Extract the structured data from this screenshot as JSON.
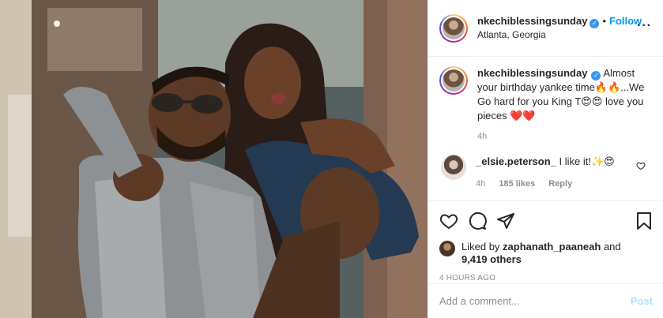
{
  "post": {
    "username": "nkechiblessingsunday",
    "verified_icon": "verified-badge-icon",
    "follow_label": "Follow",
    "separator": "•",
    "location": "Atlanta, Georgia",
    "more_label": "···"
  },
  "caption": {
    "username": "nkechiblessingsunday",
    "text": "Almost your birthday yankee time🔥🔥...We Go hard for you King T😍😍 love you pieces ❤️❤️",
    "time": "4h"
  },
  "comments": [
    {
      "username": "_elsie.peterson_",
      "text": "I like it!✨😍",
      "time": "4h",
      "likes": "185 likes",
      "reply_label": "Reply"
    }
  ],
  "actions": {
    "icons": [
      "heart-icon",
      "comment-icon",
      "share-icon",
      "bookmark-icon"
    ]
  },
  "likes": {
    "prefix": "Liked by",
    "user": "zaphanath_paaneah",
    "conjunction": "and",
    "others": "9,419 others"
  },
  "timestamp": "4 HOURS AGO",
  "add_comment": {
    "placeholder": "Add a comment...",
    "post_label": "Post"
  },
  "colors": {
    "accent": "#0095f6",
    "verified": "#3897f0",
    "muted": "#8e8e8e",
    "post_disabled": "#b2dffc",
    "heart": "#ed4956"
  }
}
